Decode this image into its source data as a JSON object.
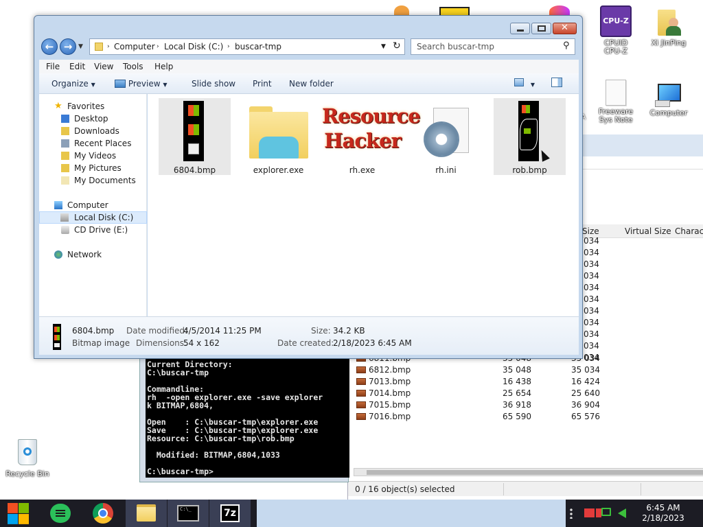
{
  "desktop": {
    "icons": [
      {
        "label": "CPUID\nCPU-Z",
        "line1": "CPUID",
        "line2": "CPU-Z",
        "badge": "CPU-Z"
      },
      {
        "label": "Xi JinPing"
      },
      {
        "line1": "Freeware",
        "line2": "Sys Note"
      },
      {
        "label": "Computer"
      },
      {
        "label": "Recycle Bin"
      }
    ],
    "partial_a": "A"
  },
  "zip_window": {
    "columns": [
      "Size",
      "Virtual Size",
      "Charact"
    ],
    "rows_above": [
      "034",
      "034",
      "034",
      "034",
      "034",
      "034",
      "034",
      "034",
      "034",
      "034",
      "034"
    ],
    "partial_row": {
      "name": "6811.bmp",
      "size": "35 048",
      "vsize": "35 034"
    },
    "rows": [
      {
        "name": "6812.bmp",
        "size": "35 048",
        "vsize": "35 034"
      },
      {
        "name": "7013.bmp",
        "size": "16 438",
        "vsize": "16 424"
      },
      {
        "name": "7014.bmp",
        "size": "25 654",
        "vsize": "25 640"
      },
      {
        "name": "7015.bmp",
        "size": "36 918",
        "vsize": "36 904"
      },
      {
        "name": "7016.bmp",
        "size": "65 590",
        "vsize": "65 576"
      }
    ],
    "status": "0 / 16 object(s) selected"
  },
  "console": {
    "lines": [
      "Current Directory:",
      "C:\\buscar-tmp",
      "",
      "Commandline:",
      "rh  -open explorer.exe -save explorer",
      "k BITMAP,6804,",
      "",
      "Open    : C:\\buscar-tmp\\explorer.exe",
      "Save    : C:\\buscar-tmp\\explorer.exe",
      "Resource: C:\\buscar-tmp\\rob.bmp",
      "",
      "  Modified: BITMAP,6804,1033",
      "",
      "C:\\buscar-tmp>"
    ]
  },
  "explorer": {
    "address": {
      "computer": "Computer",
      "disk": "Local Disk (C:)",
      "folder": "buscar-tmp"
    },
    "search_placeholder": "Search buscar-tmp",
    "menu": [
      "File",
      "Edit",
      "View",
      "Tools",
      "Help"
    ],
    "toolbar": {
      "organize": "Organize",
      "preview": "Preview",
      "slideshow": "Slide show",
      "print": "Print",
      "new_folder": "New folder"
    },
    "nav": {
      "favorites": "Favorites",
      "desktop": "Desktop",
      "downloads": "Downloads",
      "recent": "Recent Places",
      "videos": "My Videos",
      "pictures": "My Pictures",
      "documents": "My Documents",
      "computer": "Computer",
      "local_disk": "Local Disk (C:)",
      "cd_drive": "CD Drive (E:)",
      "network": "Network"
    },
    "files": [
      {
        "name": "6804.bmp",
        "icon": "bmp-thumb-icon"
      },
      {
        "name": "explorer.exe",
        "icon": "folder-icon"
      },
      {
        "name": "rh.exe",
        "icon": "resource-hacker-icon",
        "logo1": "Resource",
        "logo2": "Hacker"
      },
      {
        "name": "rh.ini",
        "icon": "ini-gear-icon"
      },
      {
        "name": "rob.bmp",
        "icon": "bmp-thumb-icon"
      }
    ],
    "details": {
      "name": "6804.bmp",
      "type": "Bitmap image",
      "modified_label": "Date modified:",
      "modified": "4/5/2014 11:25 PM",
      "dimensions_label": "Dimensions:",
      "dimensions": "54 x 162",
      "size_label": "Size:",
      "size": "34.2 KB",
      "created_label": "Date created:",
      "created": "2/18/2023 6:45 AM"
    }
  },
  "taskbar": {
    "time": "6:45 AM",
    "date": "2/18/2023",
    "apps": [
      "start-icon",
      "notes-icon",
      "chrome-icon",
      "explorer-icon",
      "console-icon",
      "7zip-icon"
    ],
    "zip_label": "7z"
  },
  "colors": {
    "accent": "#2a66b8",
    "taskbar": "#1c1c24",
    "selection": "#dcebfc"
  }
}
